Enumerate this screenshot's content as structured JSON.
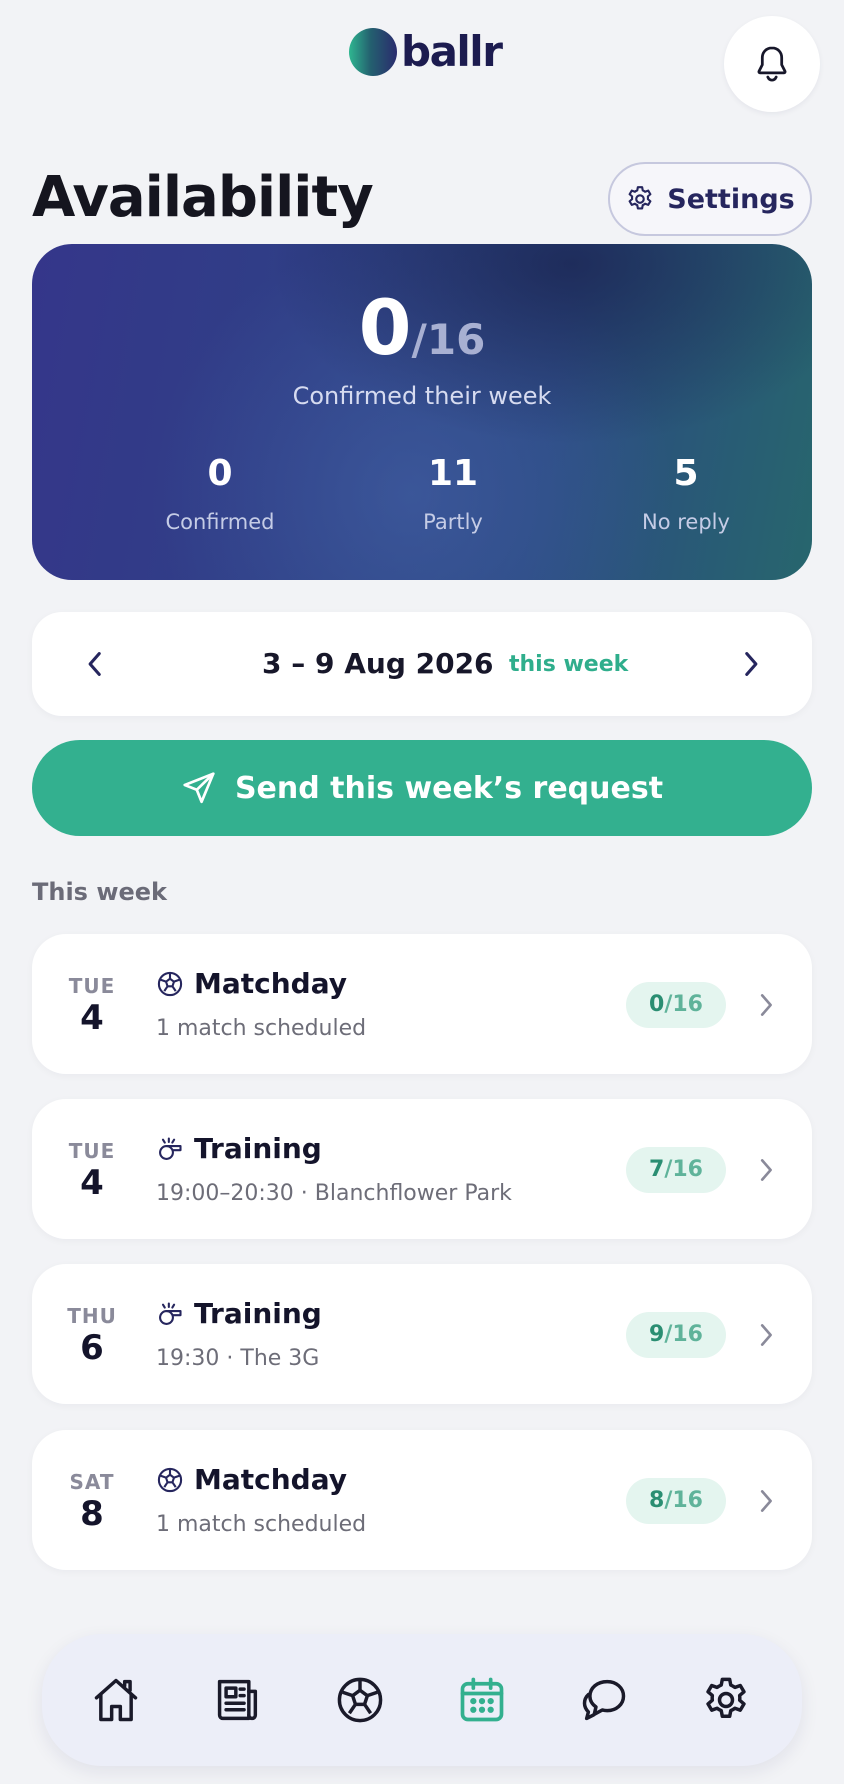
{
  "app": {
    "logo_text": "ballr"
  },
  "header": {
    "title": "Availability",
    "settings_label": "Settings"
  },
  "summary": {
    "confirmed_count": "0",
    "total": "/16",
    "caption": "Confirmed their week",
    "stats": [
      {
        "value": "0",
        "label": "Confirmed"
      },
      {
        "value": "11",
        "label": "Partly"
      },
      {
        "value": "5",
        "label": "No reply"
      }
    ]
  },
  "week": {
    "range": "3 – 9 Aug 2026",
    "tag": "this week"
  },
  "send": {
    "label": "Send this week’s request"
  },
  "list": {
    "section_title": "This week",
    "events": [
      {
        "dow": "TUE",
        "day": "4",
        "icon": "football-icon",
        "title": "Matchday",
        "subtitle": "1 match scheduled",
        "count": "0",
        "total": "/16"
      },
      {
        "dow": "TUE",
        "day": "4",
        "icon": "whistle-icon",
        "title": "Training",
        "subtitle": "19:00–20:30 · Blanchflower Park",
        "count": "7",
        "total": "/16"
      },
      {
        "dow": "THU",
        "day": "6",
        "icon": "whistle-icon",
        "title": "Training",
        "subtitle": "19:30 · The 3G",
        "count": "9",
        "total": "/16"
      },
      {
        "dow": "SAT",
        "day": "8",
        "icon": "football-icon",
        "title": "Matchday",
        "subtitle": "1 match scheduled",
        "count": "8",
        "total": "/16"
      }
    ]
  },
  "nav": {
    "items": [
      {
        "icon": "home-icon",
        "active": false
      },
      {
        "icon": "news-icon",
        "active": false
      },
      {
        "icon": "football-icon",
        "active": false
      },
      {
        "icon": "calendar-icon",
        "active": true
      },
      {
        "icon": "chat-icon",
        "active": false
      },
      {
        "icon": "gear-icon",
        "active": false
      }
    ]
  },
  "colors": {
    "accent": "#33b08f",
    "brand": "#26265e",
    "background": "#f2f3f6"
  }
}
